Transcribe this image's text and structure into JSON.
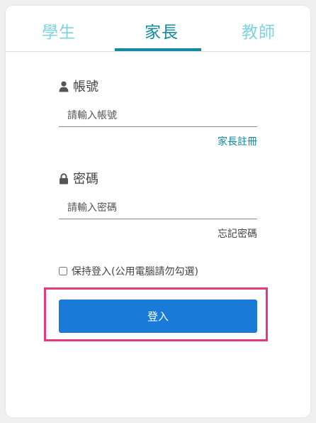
{
  "tabs": {
    "student": "學生",
    "parent": "家長",
    "teacher": "教師",
    "active": "家長"
  },
  "account": {
    "label": "帳號",
    "placeholder": "請輸入帳號",
    "value": "",
    "icon": "user-icon"
  },
  "register_link": "家長註冊",
  "password": {
    "label": "密碼",
    "placeholder": "請輸入密碼",
    "value": "",
    "icon": "lock-icon"
  },
  "forgot_link": "忘記密碼",
  "remember": {
    "label": "保持登入(公用電腦請勿勾選)",
    "checked": false
  },
  "login_button": "登入",
  "colors": {
    "accent": "#138aa0",
    "tab_inactive": "#7fd3df",
    "button": "#1a7ad8",
    "highlight": "#e23a7a"
  }
}
